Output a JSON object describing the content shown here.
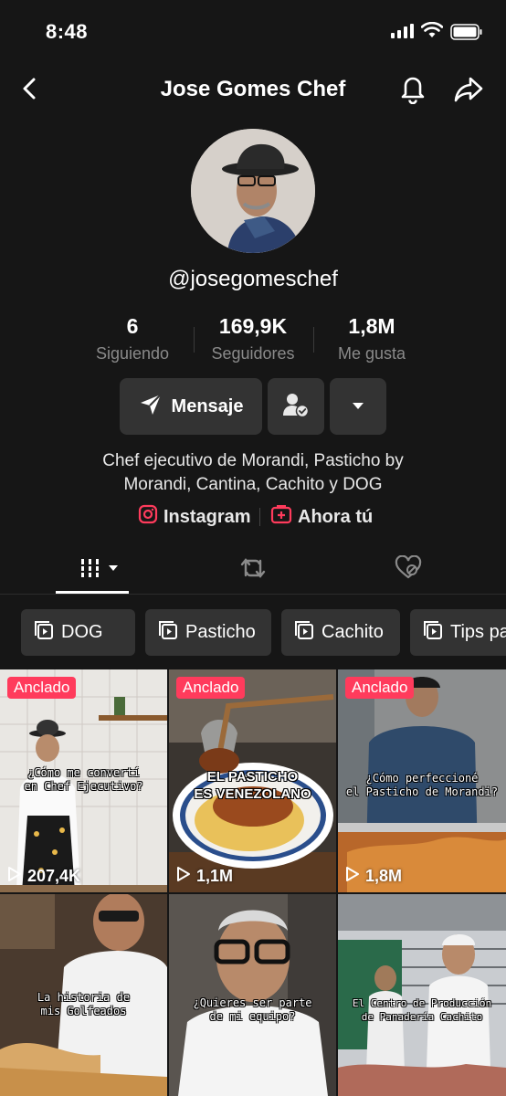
{
  "status_bar": {
    "time": "8:48"
  },
  "nav": {
    "title": "Jose Gomes Chef"
  },
  "profile": {
    "handle": "@josegomeschef",
    "stats": [
      {
        "value": "6",
        "label": "Siguiendo"
      },
      {
        "value": "169,9K",
        "label": "Seguidores"
      },
      {
        "value": "1,8M",
        "label": "Me gusta"
      }
    ],
    "message_label": "Mensaje",
    "bio_line1": "Chef ejecutivo de Morandi, Pasticho by",
    "bio_line2": "Morandi, Cantina, Cachito y DOG",
    "links": [
      {
        "label": "Instagram",
        "icon": "instagram-icon"
      },
      {
        "label": "Ahora tú",
        "icon": "add-square-icon"
      }
    ]
  },
  "tabs": [
    {
      "name": "videos",
      "icon": "grid-icon"
    },
    {
      "name": "reposts",
      "icon": "repost-icon"
    },
    {
      "name": "liked",
      "icon": "heart-hidden-icon"
    }
  ],
  "playlists": [
    {
      "label": "DOG"
    },
    {
      "label": "Pasticho"
    },
    {
      "label": "Cachito"
    },
    {
      "label": "Tips pa"
    }
  ],
  "videos": [
    {
      "pinned": "Anclado",
      "caption": "¿Cómo me convertí\nen Chef Ejecutivo?",
      "views": "207,4K"
    },
    {
      "pinned": "Anclado",
      "caption": "EL PASTICHO\nES VENEZOLANO",
      "views": "1,1M"
    },
    {
      "pinned": "Anclado",
      "caption": "¿Cómo perfeccioné\nel Pasticho de Morandi?",
      "views": "1,8M"
    },
    {
      "pinned": "",
      "caption": "La historia de\nmis Golfeados",
      "views": ""
    },
    {
      "pinned": "",
      "caption": "¿Quieres ser parte\nde mi equipo?",
      "views": ""
    },
    {
      "pinned": "",
      "caption": "El Centro de Producción\nde Panadería Cachito",
      "views": ""
    }
  ],
  "colors": {
    "background": "#161616",
    "button": "#333333",
    "pinned_badge": "#ff3b5c",
    "muted_text": "#8a8a8a"
  }
}
